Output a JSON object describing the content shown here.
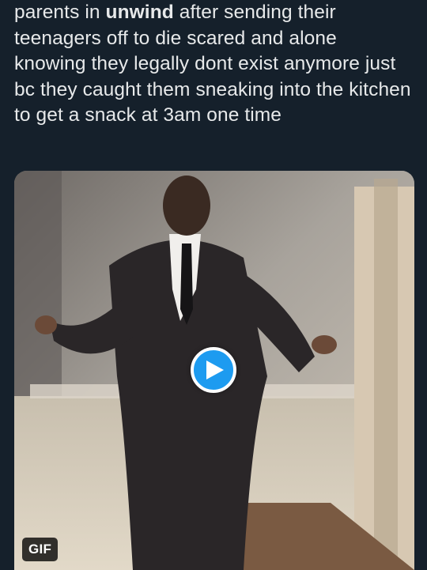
{
  "tweet": {
    "text_before": "parents in ",
    "text_bold": "unwind",
    "text_after": " after sending their teenagers off to die scared and alone knowing they legally dont exist anymore just bc they caught them sneaking into the kitchen to get a snack at 3am one time"
  },
  "media": {
    "badge": "GIF",
    "play_icon": "play-icon",
    "colors": {
      "play": "#1d9bf0",
      "background": "#15202b"
    }
  }
}
